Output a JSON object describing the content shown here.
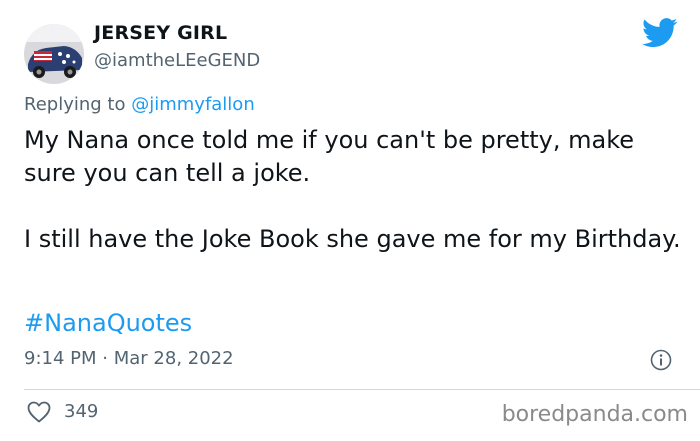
{
  "author": {
    "name": "JERSEY GIRL",
    "handle": "@iamtheLEeGEND"
  },
  "reply": {
    "prefix": "Replying to",
    "mention": "@jimmyfallon"
  },
  "tweet": {
    "line1": "My Nana once told me if you can't be pretty, make sure you can tell a joke.",
    "line2": "I still have the Joke Book she gave me for my Birthday.",
    "hashtag": "#NanaQuotes",
    "time": "9:14 PM",
    "separator": "·",
    "date": "Mar 28, 2022"
  },
  "engagement": {
    "likes": "349"
  },
  "watermark": "boredpanda.com",
  "icons": {
    "avatar": "avatar-car-flag",
    "platform": "twitter-bird-icon",
    "info": "info-icon",
    "like": "heart-icon"
  },
  "colors": {
    "accent": "#1d9bf0",
    "secondary_text": "#536471",
    "primary_text": "#0f1419"
  }
}
